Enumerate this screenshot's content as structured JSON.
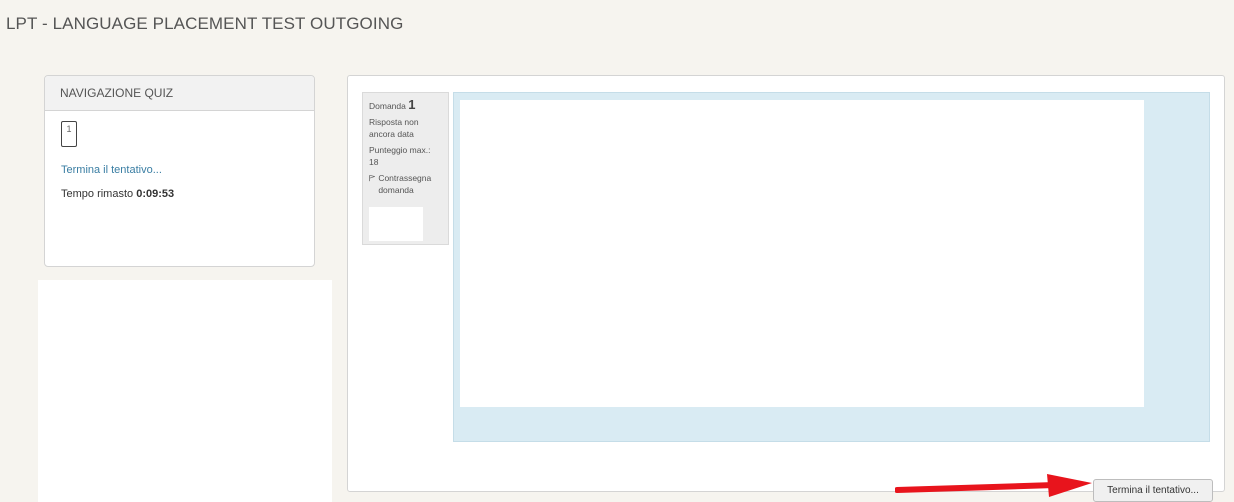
{
  "page": {
    "title": "LPT - LANGUAGE PLACEMENT TEST OUTGOING"
  },
  "nav": {
    "header": "NAVIGAZIONE QUIZ",
    "question_buttons": [
      "1"
    ],
    "finish_link": "Termina il tentativo...",
    "time_label": "Tempo rimasto",
    "time_value": "0:09:53"
  },
  "question": {
    "label": "Domanda",
    "number": "1",
    "status": "Risposta non ancora data",
    "max_points": "Punteggio max.: 18",
    "flag_label": "Contrassegna domanda",
    "flag_icon": "flag-icon"
  },
  "footer": {
    "finish_button": "Termina il tentativo..."
  },
  "annotation": {
    "arrow_color": "#e8141c"
  }
}
